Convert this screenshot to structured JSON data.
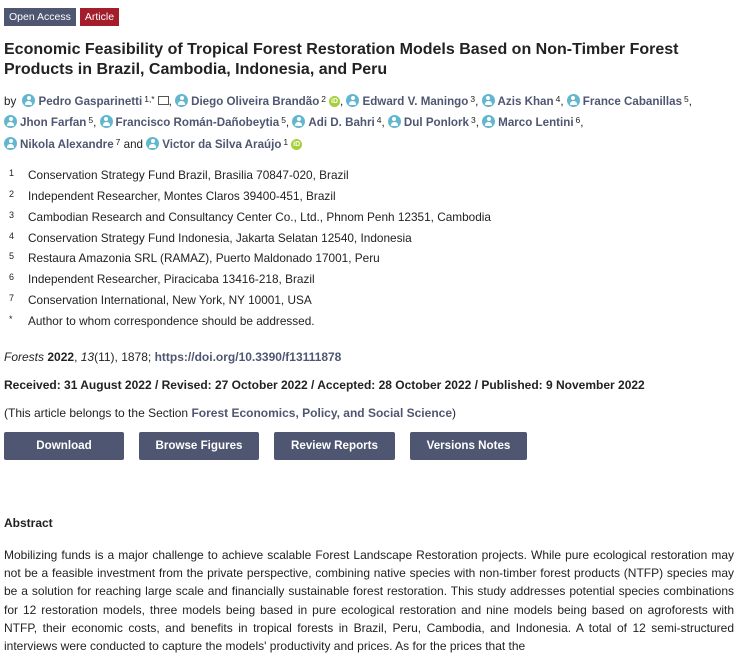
{
  "badges": {
    "open_access": "Open Access",
    "article": "Article"
  },
  "title": "Economic Feasibility of Tropical Forest Restoration Models Based on Non-Timber Forest Products in Brazil, Cambodia, Indonesia, and Peru",
  "by_label": "by",
  "and_label": "and",
  "authors": [
    {
      "name": "Pedro Gasparinetti",
      "sup": "1,*"
    },
    {
      "name": "Diego Oliveira Brandão",
      "sup": "2"
    },
    {
      "name": "Edward V. Maningo",
      "sup": "3"
    },
    {
      "name": "Azis Khan",
      "sup": "4"
    },
    {
      "name": "France Cabanillas",
      "sup": "5"
    },
    {
      "name": "Jhon Farfan",
      "sup": "5"
    },
    {
      "name": "Francisco Román-Dañobeytia",
      "sup": "5"
    },
    {
      "name": "Adi D. Bahri",
      "sup": "4"
    },
    {
      "name": "Dul Ponlork",
      "sup": "3"
    },
    {
      "name": "Marco Lentini",
      "sup": "6"
    },
    {
      "name": "Nikola Alexandre",
      "sup": "7"
    },
    {
      "name": "Victor da Silva Araújo",
      "sup": "1"
    }
  ],
  "affiliations": [
    {
      "n": "1",
      "text": "Conservation Strategy Fund Brazil, Brasilia 70847-020, Brazil"
    },
    {
      "n": "2",
      "text": "Independent Researcher, Montes Claros 39400-451, Brazil"
    },
    {
      "n": "3",
      "text": "Cambodian Research and Consultancy Center Co., Ltd., Phnom Penh 12351, Cambodia"
    },
    {
      "n": "4",
      "text": "Conservation Strategy Fund Indonesia, Jakarta Selatan 12540, Indonesia"
    },
    {
      "n": "5",
      "text": "Restaura Amazonia SRL (RAMAZ), Puerto Maldonado 17001, Peru"
    },
    {
      "n": "6",
      "text": "Independent Researcher, Piracicaba 13416-218, Brazil"
    },
    {
      "n": "7",
      "text": "Conservation International, New York, NY 10001, USA"
    },
    {
      "n": "*",
      "text": "Author to whom correspondence should be addressed."
    }
  ],
  "citation": {
    "journal": "Forests",
    "year": "2022",
    "volume": "13",
    "rest": "(11), 1878;",
    "doi": "https://doi.org/10.3390/f13111878"
  },
  "dates": "Received: 31 August 2022 / Revised: 27 October 2022 / Accepted: 28 October 2022 / Published: 9 November 2022",
  "section": {
    "prefix": "(This article belongs to the Section",
    "link": "Forest Economics, Policy, and Social Science",
    "suffix": ")"
  },
  "buttons": {
    "download": "Download",
    "browse": "Browse Figures",
    "review": "Review Reports",
    "versions": "Versions Notes"
  },
  "abstract_heading": "Abstract",
  "abstract_text": "Mobilizing funds is a major challenge to achieve scalable Forest Landscape Restoration projects. While pure ecological restoration may not be a feasible investment from the private perspective, combining native species with non-timber forest products (NTFP) species may be a solution for reaching large scale and financially sustainable forest restoration. This study addresses potential species combinations for 12 restoration models, three models being based in pure ecological restoration and nine models being based on agroforests with NTFP, their economic costs, and benefits in tropical forests in Brazil, Peru, Cambodia, and Indonesia. A total of 12 semi-structured interviews were conducted to capture the models' productivity and prices. As for the prices that the",
  "colors": {
    "accent": "#4f5671",
    "article_badge": "#a31d2b",
    "person_icon": "#62b7cf",
    "orcid": "#a6ce39"
  }
}
